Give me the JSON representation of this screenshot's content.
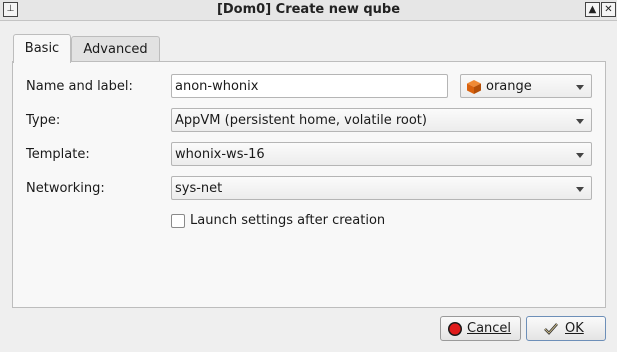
{
  "window": {
    "title": "[Dom0] Create new qube",
    "menu_symbol": "⊥",
    "maximize_symbol": "▲",
    "close_symbol": "✕"
  },
  "tabs": [
    {
      "label": "Basic",
      "active": true
    },
    {
      "label": "Advanced",
      "active": false
    }
  ],
  "form": {
    "name_label": "Name and label:",
    "name_value": "anon-whonix",
    "color_label_value": "orange",
    "color_accent": "#d9620e",
    "type_label": "Type:",
    "type_value": "AppVM (persistent home, volatile root)",
    "template_label": "Template:",
    "template_value": "whonix-ws-16",
    "networking_label": "Networking:",
    "networking_value": "sys-net",
    "launch_settings_label": "Launch settings after creation",
    "launch_settings_checked": false
  },
  "buttons": {
    "cancel_label": "Cancel",
    "ok_label": "OK"
  }
}
